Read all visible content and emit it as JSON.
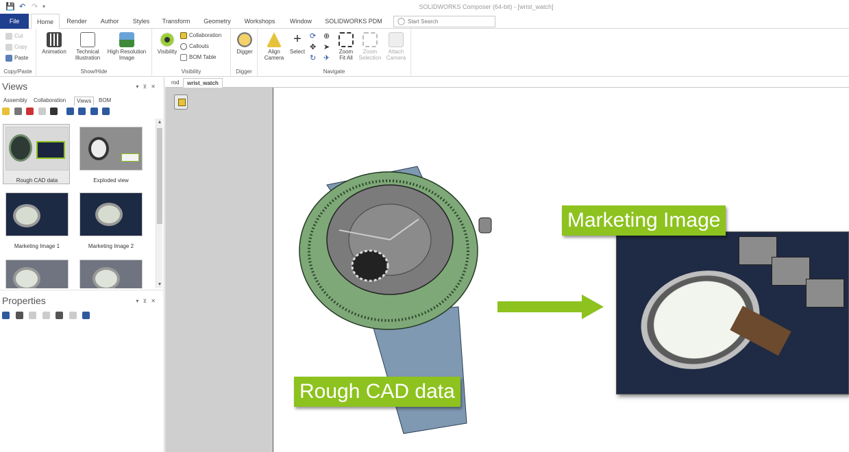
{
  "app": {
    "title": "SOLIDWORKS Composer (64-bit) - [wrist_watch]"
  },
  "colors": {
    "file_tab": "#1f3f8f",
    "callout_green": "#8dc21f",
    "arrow_green": "#8dc21f"
  },
  "ribbon_tabs": [
    "File",
    "Home",
    "Render",
    "Author",
    "Styles",
    "Transform",
    "Geometry",
    "Workshops",
    "Window",
    "SOLIDWORKS PDM"
  ],
  "search": {
    "placeholder": "Start Search"
  },
  "ribbon": {
    "copy_paste": {
      "cut": "Cut",
      "copy": "Copy",
      "paste": "Paste",
      "label": "Copy/Paste"
    },
    "show_hide": {
      "animation": "Animation",
      "technical": "Technical Illustration",
      "technical_l1": "Technical",
      "technical_l2": "Illustration",
      "hires_l1": "High Resolution",
      "hires_l2": "Image",
      "label": "Show/Hide"
    },
    "visibility": {
      "visibility": "Visibility",
      "collaboration": "Collaboration",
      "callouts": "Callouts",
      "bom_table": "BOM Table",
      "label": "Visibility"
    },
    "digger": {
      "digger": "Digger",
      "label": "Digger"
    },
    "navigate": {
      "align_l1": "Align",
      "align_l2": "Camera",
      "select": "Select",
      "zoom_l1": "Zoom",
      "zoom_l2": "Fit All",
      "zoomsel_l1": "Zoom",
      "zoomsel_l2": "Selection",
      "attach_l1": "Attach",
      "attach_l2": "Camera",
      "label": "Navigate"
    }
  },
  "views_panel": {
    "title": "Views",
    "tabs": [
      "Assembly",
      "Collaboration",
      "Views",
      "BOM"
    ],
    "thumbnails": [
      {
        "label": "Rough CAD data"
      },
      {
        "label": "Exploded view"
      },
      {
        "label": "Marketing Image 1"
      },
      {
        "label": "Marketing Image 2"
      },
      {
        "label": ""
      },
      {
        "label": ""
      }
    ]
  },
  "properties_panel": {
    "title": "Properties"
  },
  "doc_tabs": [
    "rod",
    "wrist_watch"
  ],
  "viewport": {
    "callout_rough": "Rough  CAD data",
    "callout_marketing": "Marketing Image"
  }
}
